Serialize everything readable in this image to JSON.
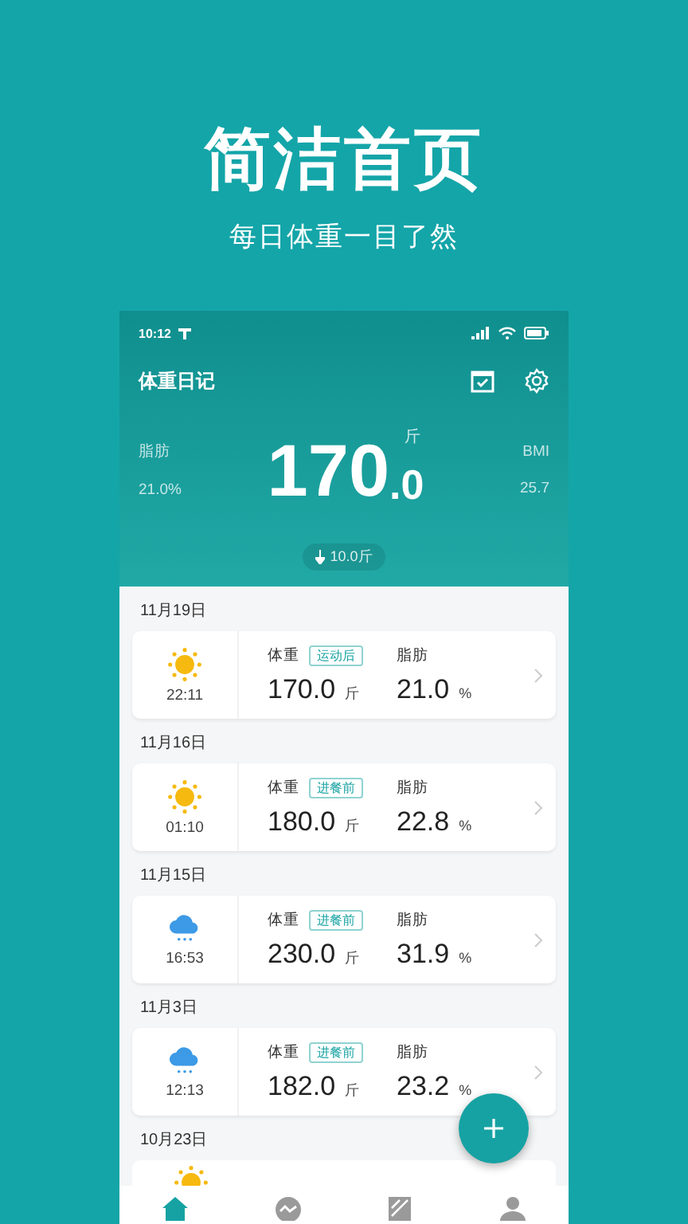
{
  "promo": {
    "title": "简洁首页",
    "subtitle": "每日体重一目了然"
  },
  "status_bar": {
    "time": "10:12"
  },
  "app_bar": {
    "title": "体重日记"
  },
  "summary": {
    "fat_label": "脂肪",
    "fat_value": "21.0%",
    "weight_integer": "170",
    "weight_decimal": ".0",
    "unit": "斤",
    "bmi_label": "BMI",
    "bmi_value": "25.7",
    "change": {
      "kind": "decrease",
      "text": "10.0斤"
    }
  },
  "records": [
    {
      "date": "11月19日",
      "kind": "sunny",
      "time": "22:11",
      "weight_label": "体重",
      "tag": "运动后",
      "weight": "170.0",
      "weight_unit": "斤",
      "fat_label": "脂肪",
      "fat": "21.0",
      "fat_unit": "%"
    },
    {
      "date": "11月16日",
      "kind": "sunny",
      "time": "01:10",
      "weight_label": "体重",
      "tag": "进餐前",
      "weight": "180.0",
      "weight_unit": "斤",
      "fat_label": "脂肪",
      "fat": "22.8",
      "fat_unit": "%"
    },
    {
      "date": "11月15日",
      "kind": "rainy",
      "time": "16:53",
      "weight_label": "体重",
      "tag": "进餐前",
      "weight": "230.0",
      "weight_unit": "斤",
      "fat_label": "脂肪",
      "fat": "31.9",
      "fat_unit": "%"
    },
    {
      "date": "11月3日",
      "kind": "rainy",
      "time": "12:13",
      "weight_label": "体重",
      "tag": "进餐前",
      "weight": "182.0",
      "weight_unit": "斤",
      "fat_label": "脂肪",
      "fat": "23.2",
      "fat_unit": "%"
    }
  ],
  "partial_record": {
    "date": "10月23日",
    "kind": "sunny"
  },
  "nav": [
    {
      "selected": true
    },
    {
      "selected": false
    },
    {
      "selected": false
    },
    {
      "selected": false
    }
  ]
}
